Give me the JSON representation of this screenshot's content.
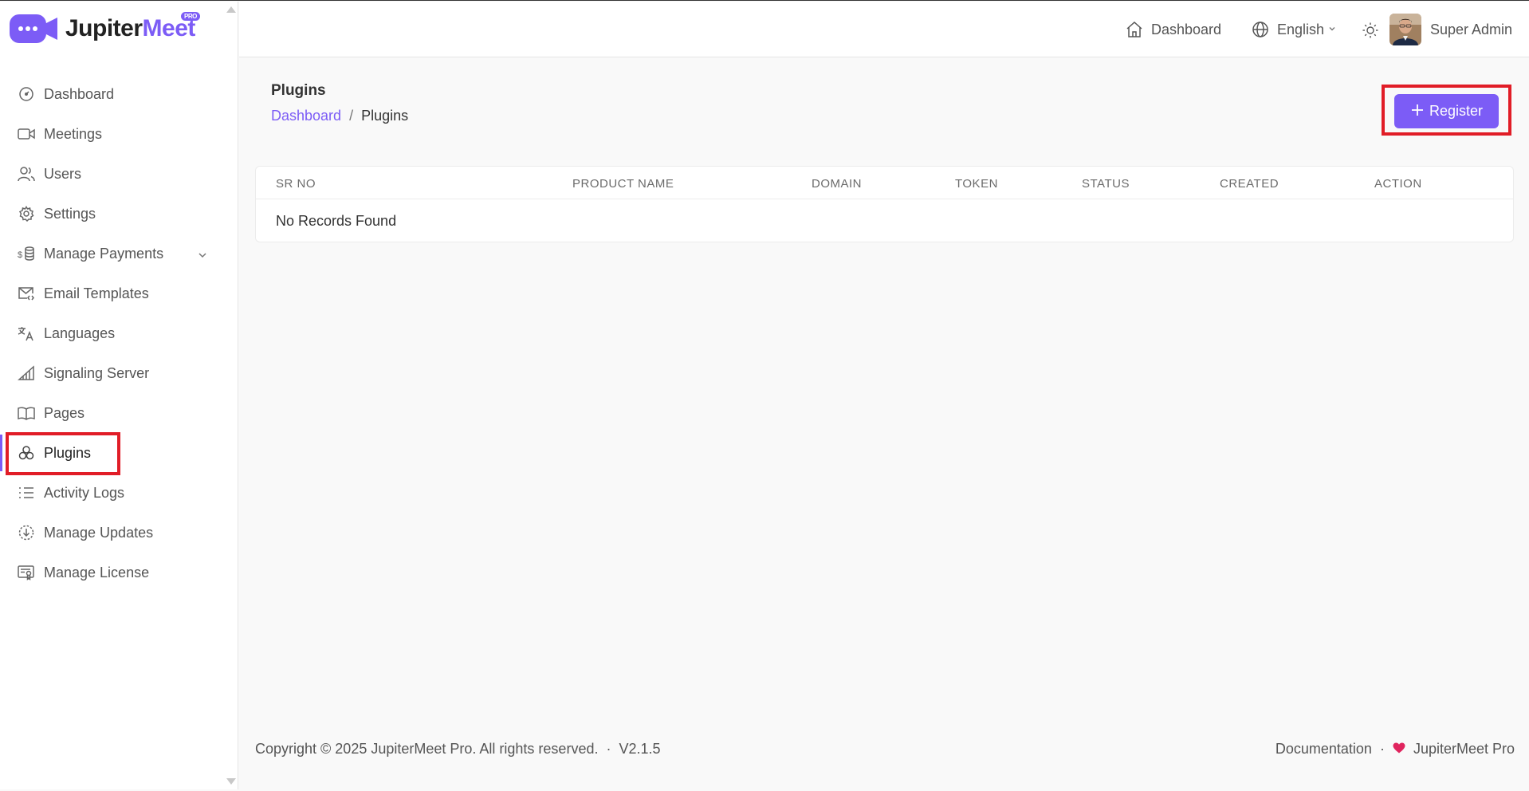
{
  "brand": {
    "name_part1": "Jupiter",
    "name_part2": "Meet",
    "badge": "PRO"
  },
  "sidebar": {
    "items": [
      {
        "label": "Dashboard",
        "icon": "gauge-icon"
      },
      {
        "label": "Meetings",
        "icon": "video-icon"
      },
      {
        "label": "Users",
        "icon": "users-icon"
      },
      {
        "label": "Settings",
        "icon": "gear-icon"
      },
      {
        "label": "Manage Payments",
        "icon": "coins-icon",
        "expandable": true
      },
      {
        "label": "Email Templates",
        "icon": "mail-code-icon"
      },
      {
        "label": "Languages",
        "icon": "translate-icon"
      },
      {
        "label": "Signaling Server",
        "icon": "signal-icon"
      },
      {
        "label": "Pages",
        "icon": "book-icon"
      },
      {
        "label": "Plugins",
        "icon": "plugins-icon",
        "active": true
      },
      {
        "label": "Activity Logs",
        "icon": "list-icon"
      },
      {
        "label": "Manage Updates",
        "icon": "download-circle-icon"
      },
      {
        "label": "Manage License",
        "icon": "license-icon"
      }
    ]
  },
  "topbar": {
    "dashboard_label": "Dashboard",
    "language_label": "English",
    "user_name": "Super Admin"
  },
  "page": {
    "title": "Plugins",
    "breadcrumb": {
      "home": "Dashboard",
      "separator": "/",
      "current": "Plugins"
    },
    "register_label": "Register"
  },
  "table": {
    "columns": [
      "SR NO",
      "PRODUCT NAME",
      "DOMAIN",
      "TOKEN",
      "STATUS",
      "CREATED",
      "ACTION"
    ],
    "empty_message": "No Records Found"
  },
  "footer": {
    "copyright": "Copyright © 2025 JupiterMeet Pro. All rights reserved.",
    "dot": "·",
    "version": "V2.1.5",
    "documentation": "Documentation",
    "brand": "JupiterMeet Pro"
  },
  "colors": {
    "accent": "#7c5cf6",
    "highlight": "#e11d27",
    "heart": "#e0245e"
  }
}
